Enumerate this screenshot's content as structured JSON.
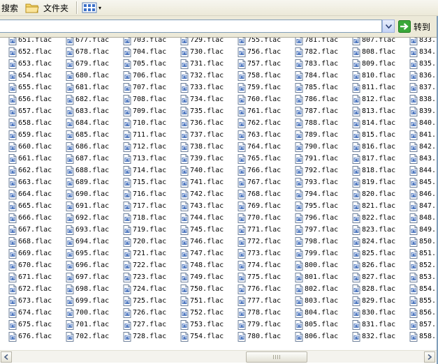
{
  "toolbar": {
    "search_label": "搜索",
    "folders_label": "文件夹",
    "views_icon": "views-icon"
  },
  "addressbar": {
    "value": "",
    "go_label": "转到"
  },
  "files": {
    "columns": [
      [
        "651.flac",
        "652.flac",
        "653.flac",
        "654.flac",
        "655.flac",
        "656.flac",
        "657.flac",
        "658.flac",
        "659.flac",
        "660.flac",
        "661.flac",
        "662.flac",
        "663.flac",
        "664.flac",
        "665.flac",
        "666.flac",
        "667.flac",
        "668.flac",
        "669.flac",
        "670.flac",
        "671.flac",
        "672.flac",
        "673.flac",
        "674.flac",
        "675.flac",
        "676.flac"
      ],
      [
        "677.flac",
        "678.flac",
        "679.flac",
        "680.flac",
        "681.flac",
        "682.flac",
        "683.flac",
        "684.flac",
        "685.flac",
        "686.flac",
        "687.flac",
        "688.flac",
        "689.flac",
        "690.flac",
        "691.flac",
        "692.flac",
        "693.flac",
        "694.flac",
        "695.flac",
        "696.flac",
        "697.flac",
        "698.flac",
        "699.flac",
        "700.flac",
        "701.flac",
        "702.flac"
      ],
      [
        "703.flac",
        "704.flac",
        "705.flac",
        "706.flac",
        "707.flac",
        "708.flac",
        "709.flac",
        "710.flac",
        "711.flac",
        "712.flac",
        "713.flac",
        "714.flac",
        "715.flac",
        "716.flac",
        "717.flac",
        "718.flac",
        "719.flac",
        "720.flac",
        "721.flac",
        "722.flac",
        "723.flac",
        "724.flac",
        "725.flac",
        "726.flac",
        "727.flac",
        "728.flac"
      ],
      [
        "729.flac",
        "730.flac",
        "731.flac",
        "732.flac",
        "733.flac",
        "734.flac",
        "735.flac",
        "736.flac",
        "737.flac",
        "738.flac",
        "739.flac",
        "740.flac",
        "741.flac",
        "742.flac",
        "743.flac",
        "744.flac",
        "745.flac",
        "746.flac",
        "747.flac",
        "748.flac",
        "749.flac",
        "750.flac",
        "751.flac",
        "752.flac",
        "753.flac",
        "754.flac"
      ],
      [
        "755.flac",
        "756.flac",
        "757.flac",
        "758.flac",
        "759.flac",
        "760.flac",
        "761.flac",
        "762.flac",
        "763.flac",
        "764.flac",
        "765.flac",
        "766.flac",
        "767.flac",
        "768.flac",
        "769.flac",
        "770.flac",
        "771.flac",
        "772.flac",
        "773.flac",
        "774.flac",
        "775.flac",
        "776.flac",
        "777.flac",
        "778.flac",
        "779.flac",
        "780.flac"
      ],
      [
        "781.flac",
        "782.flac",
        "783.flac",
        "784.flac",
        "785.flac",
        "786.flac",
        "787.flac",
        "788.flac",
        "789.flac",
        "790.flac",
        "791.flac",
        "792.flac",
        "793.flac",
        "794.flac",
        "795.flac",
        "796.flac",
        "797.flac",
        "798.flac",
        "799.flac",
        "800.flac",
        "801.flac",
        "802.flac",
        "803.flac",
        "804.flac",
        "805.flac",
        "806.flac"
      ],
      [
        "807.flac",
        "808.flac",
        "809.flac",
        "810.flac",
        "811.flac",
        "812.flac",
        "813.flac",
        "814.flac",
        "815.flac",
        "816.flac",
        "817.flac",
        "818.flac",
        "819.flac",
        "820.flac",
        "821.flac",
        "822.flac",
        "823.flac",
        "824.flac",
        "825.flac",
        "826.flac",
        "827.flac",
        "828.flac",
        "829.flac",
        "830.flac",
        "831.flac",
        "832.flac"
      ],
      [
        "833.",
        "834.",
        "835.",
        "836.",
        "837.",
        "838.",
        "839.",
        "840.",
        "841.",
        "842.",
        "843.",
        "844.",
        "845.",
        "846.",
        "847.",
        "848.",
        "849.",
        "850.",
        "851.",
        "852.",
        "853.",
        "854.",
        "855.",
        "856.",
        "857.",
        "858."
      ]
    ]
  },
  "colors": {
    "window_border": "#7f9db9",
    "go_arrow": "#2e9a2e",
    "toolbar_bg": "#ece9d8"
  }
}
